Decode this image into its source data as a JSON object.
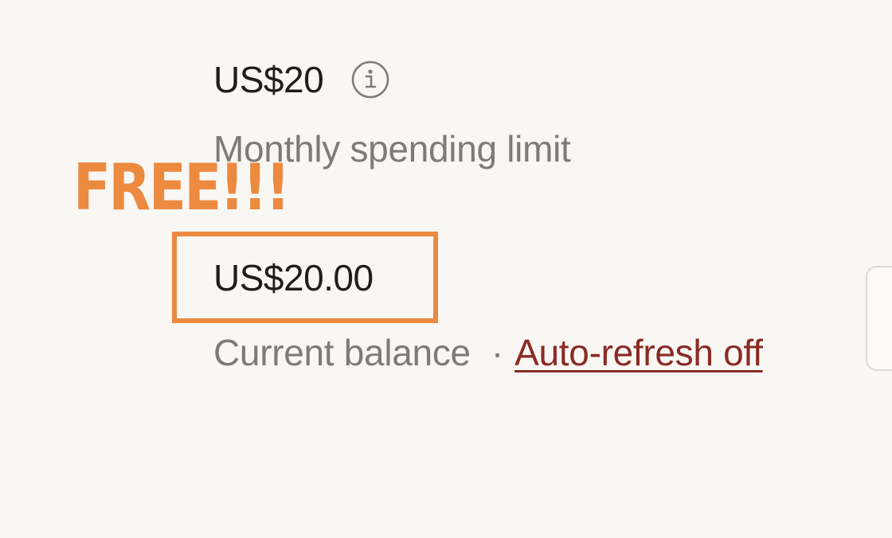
{
  "spending_limit": {
    "amount": "US$20",
    "label": "Monthly spending limit",
    "info_icon": "info-icon"
  },
  "overlay": {
    "text": "FREE!!!",
    "color": "#ec8a40"
  },
  "balance": {
    "amount": "US$20.00",
    "label": "Current balance",
    "separator": "·",
    "auto_refresh_label": "Auto-refresh off"
  },
  "colors": {
    "background": "#f9f7f3",
    "primary_text": "#1f1e1c",
    "muted_text": "#7d7b77",
    "link": "#8a2a24",
    "highlight": "#ec8a40"
  }
}
